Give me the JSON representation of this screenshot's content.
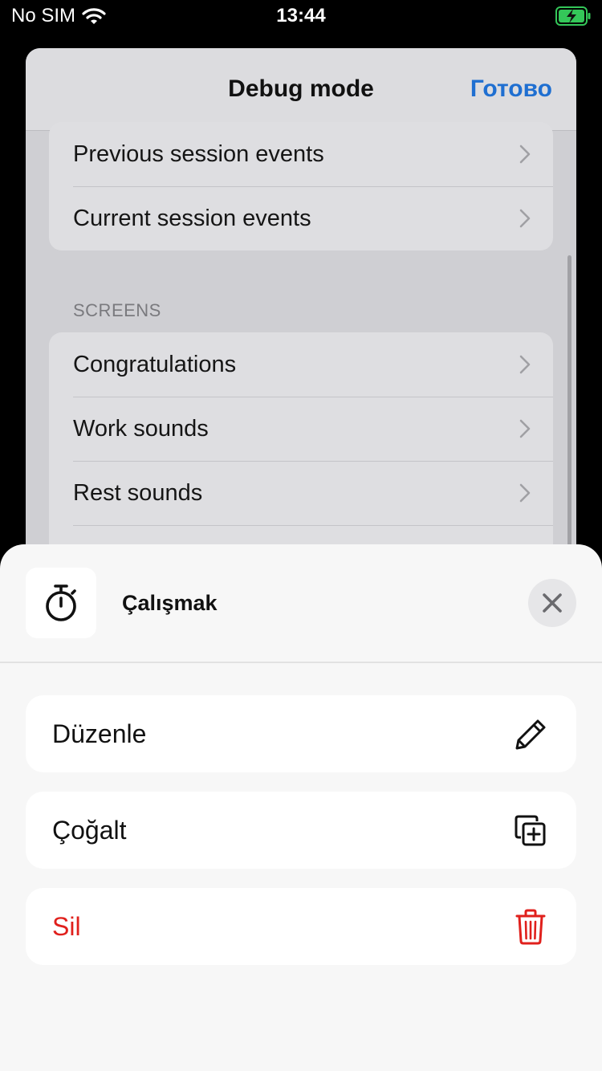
{
  "status_bar": {
    "carrier": "No SIM",
    "time": "13:44"
  },
  "debug_modal": {
    "title": "Debug mode",
    "done_label": "Готово",
    "group1": [
      {
        "label": "Previous session events"
      },
      {
        "label": "Current session events"
      }
    ],
    "screens_header": "SCREENS",
    "group2": [
      {
        "label": "Congratulations"
      },
      {
        "label": "Work sounds"
      },
      {
        "label": "Rest sounds"
      }
    ]
  },
  "sheet": {
    "title": "Çalışmak",
    "actions": [
      {
        "label": "Düzenle",
        "icon": "pencil-icon"
      },
      {
        "label": "Çoğalt",
        "icon": "duplicate-icon"
      },
      {
        "label": "Sil",
        "icon": "trash-icon",
        "color": "#e0201c"
      }
    ]
  },
  "colors": {
    "accent_blue": "#1f6fd1",
    "danger_red": "#e0201c",
    "battery_green": "#34c759"
  }
}
